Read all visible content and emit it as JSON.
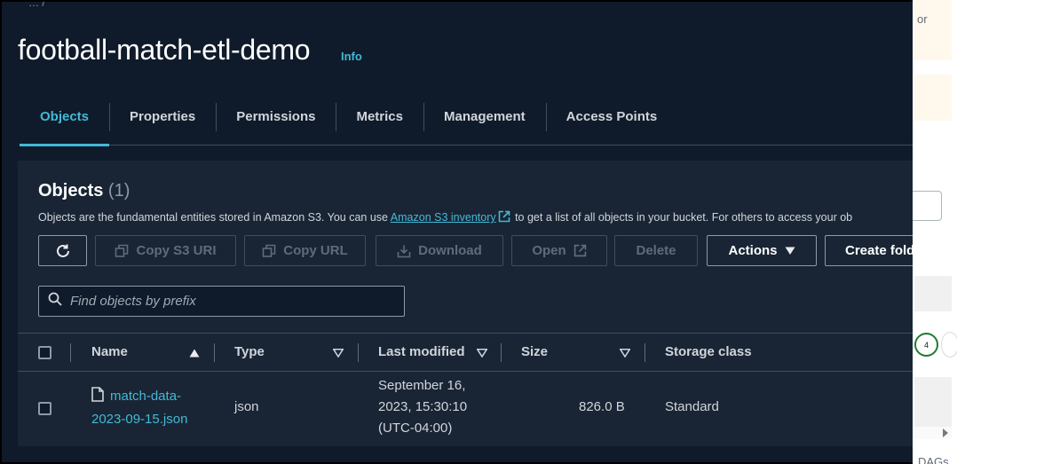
{
  "breadcrumb_fragment": "… /",
  "bucket": {
    "title": "football-match-etl-demo",
    "info_label": "Info"
  },
  "tabs": [
    {
      "label": "Objects",
      "active": true
    },
    {
      "label": "Properties",
      "active": false
    },
    {
      "label": "Permissions",
      "active": false
    },
    {
      "label": "Metrics",
      "active": false
    },
    {
      "label": "Management",
      "active": false
    },
    {
      "label": "Access Points",
      "active": false
    }
  ],
  "objects_panel": {
    "title": "Objects",
    "count": "(1)",
    "desc_before": "Objects are the fundamental entities stored in Amazon S3. You can use ",
    "desc_link": "Amazon S3 inventory",
    "desc_after": " to get a list of all objects in your bucket. For others to access your ob"
  },
  "toolbar": {
    "refresh_icon": "refresh-icon",
    "copy_s3_uri": "Copy S3 URI",
    "copy_url": "Copy URL",
    "download": "Download",
    "open": "Open",
    "delete": "Delete",
    "actions": "Actions",
    "create_folder": "Create fold"
  },
  "search": {
    "placeholder": "Find objects by prefix",
    "value": ""
  },
  "table": {
    "columns": [
      "Name",
      "Type",
      "Last modified",
      "Size",
      "Storage class"
    ],
    "rows": [
      {
        "name_line1": "match-data-",
        "name_line2": "2023-09-15.json",
        "type": "json",
        "modified_line1": "September 16,",
        "modified_line2": "2023, 15:30:10",
        "modified_line3": "(UTC-04:00)",
        "size": "826.0 B",
        "storage_class": "Standard"
      }
    ]
  },
  "right_pane": {
    "note_fragment": "or",
    "step_number": "4",
    "dags_fragment": "DAGs"
  },
  "colors": {
    "accent": "#44b9d6",
    "background": "#0f1b2a",
    "panel": "#192534",
    "status_green": "#1d7a2f"
  }
}
